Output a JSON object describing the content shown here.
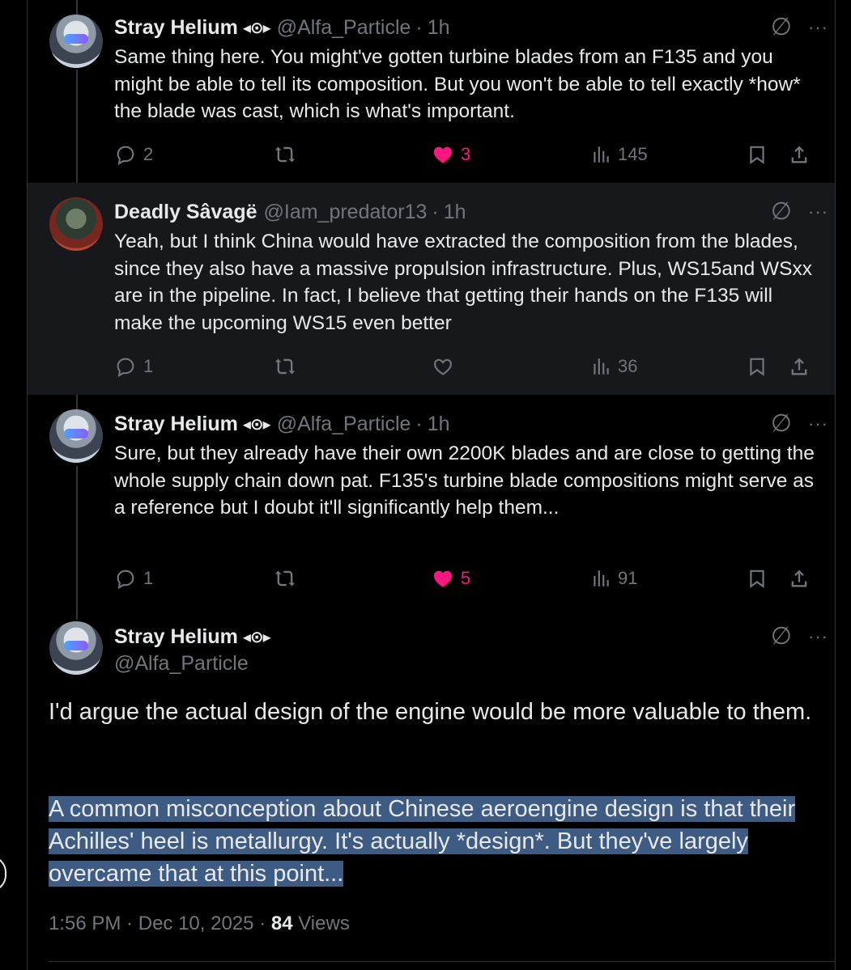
{
  "replies": [
    {
      "name": "Stray Helium",
      "badge": "◂⊙▸",
      "handle": "@Alfa_Particle",
      "time": "1h",
      "text": "Same thing here. You might've gotten turbine blades from an F135 and you might be able to tell its composition. But you won't be able to tell exactly *how* the blade was cast, which is what's important.",
      "replies": "2",
      "reposts": "",
      "likes": "3",
      "liked": true,
      "views": "145"
    },
    {
      "name": "Deadly Sâvagë",
      "badge": "",
      "handle": "@Iam_predator13",
      "time": "1h",
      "text": "Yeah, but I think China would have extracted the composition from the blades, since they also have a massive propulsion infrastructure. Plus, WS15and WSxx are in the pipeline. In fact, I believe that getting their hands on the F135 will make the upcoming WS15 even better",
      "replies": "1",
      "reposts": "",
      "likes": "",
      "liked": false,
      "views": "36"
    },
    {
      "name": "Stray Helium",
      "badge": "◂⊙▸",
      "handle": "@Alfa_Particle",
      "time": "1h",
      "text": "Sure, but they already have their own 2200K blades and are close to getting the whole supply chain down pat. F135's turbine blade compositions might serve as a reference but I doubt it'll significantly help them...",
      "replies": "1",
      "reposts": "",
      "likes": "5",
      "liked": true,
      "views": "91"
    }
  ],
  "main": {
    "name": "Stray Helium",
    "badge": "◂⊙▸",
    "handle": "@Alfa_Particle",
    "para1": "I'd argue the actual design of the engine would be more valuable to them.",
    "para2_lines": [
      "A common misconception about Chinese aeroengine design is that their",
      "Achilles' heel is metallurgy. It's actually *design*. But they've largely",
      "overcame that at this point..."
    ],
    "time": "1:56 PM",
    "date": "Dec 10, 2025",
    "views_count": "84",
    "views_label": "Views"
  },
  "icons": {
    "grok": "∅",
    "more": "···"
  },
  "colors": {
    "accent_like": "#f91880",
    "muted": "#71767b",
    "selection": "#3e5b84",
    "highlight_row": "#16181c"
  }
}
